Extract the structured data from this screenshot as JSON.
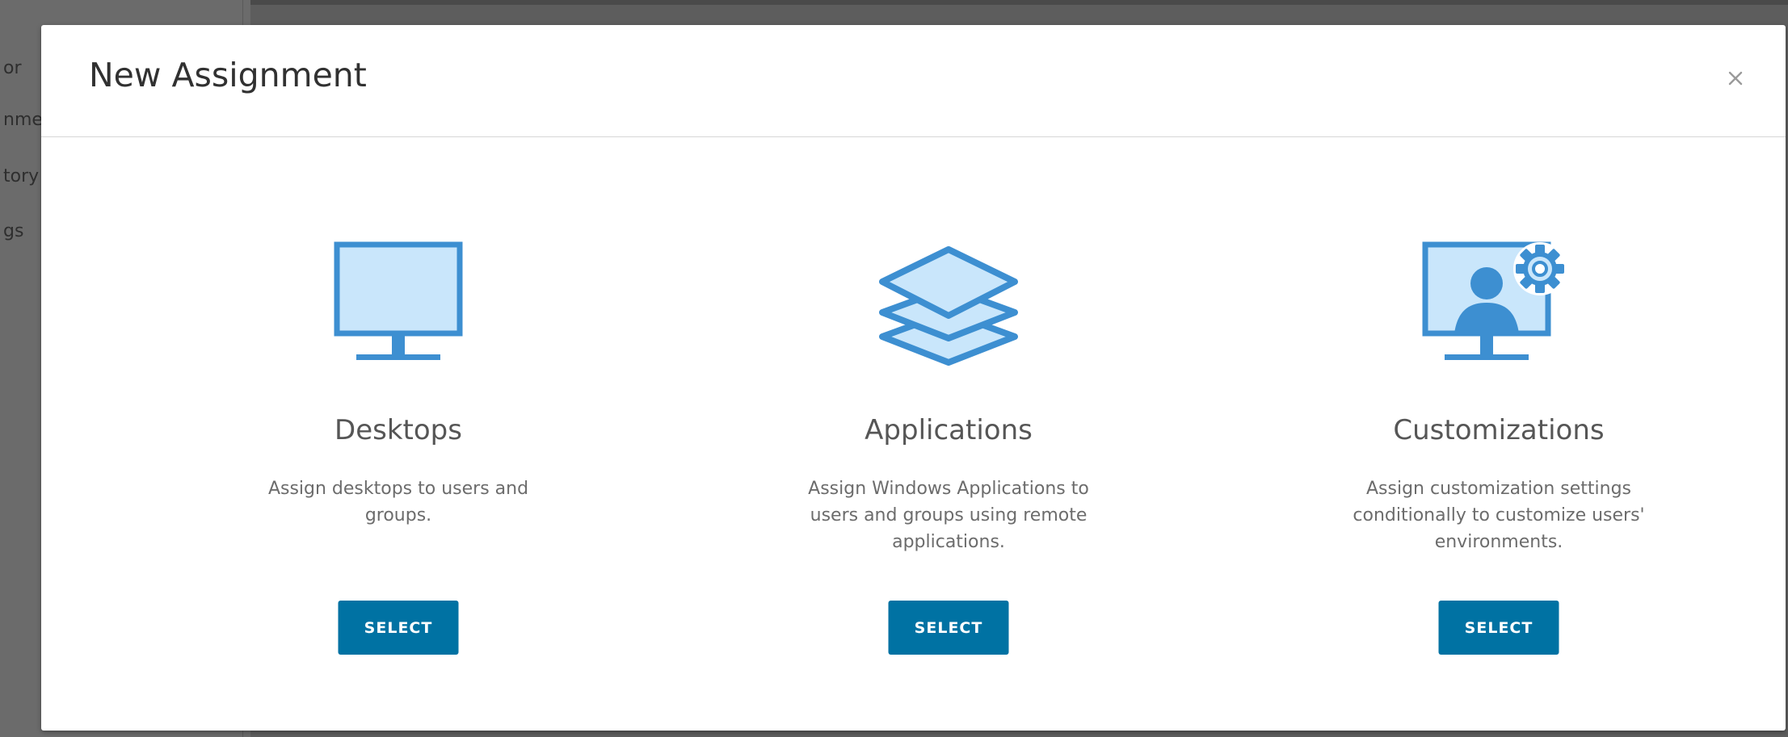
{
  "background": {
    "nav_fragments": [
      "or",
      "nme",
      "tory",
      "gs"
    ]
  },
  "modal": {
    "title": "New Assignment",
    "close_label": "×",
    "options": [
      {
        "icon": "desktop-monitor-icon",
        "title": "Desktops",
        "description": "Assign desktops to users and groups.",
        "button_label": "SELECT"
      },
      {
        "icon": "stacked-layers-icon",
        "title": "Applications",
        "description": "Assign Windows Applications to users and groups using remote applications.",
        "button_label": "SELECT"
      },
      {
        "icon": "user-monitor-gear-icon",
        "title": "Customizations",
        "description": "Assign customization settings conditionally to customize users' environments.",
        "button_label": "SELECT"
      }
    ]
  },
  "colors": {
    "primary": "#0072a3",
    "icon_blue": "#3d8fd1",
    "icon_fill": "#c9e6fb",
    "overlay": "#5d5d5d"
  }
}
